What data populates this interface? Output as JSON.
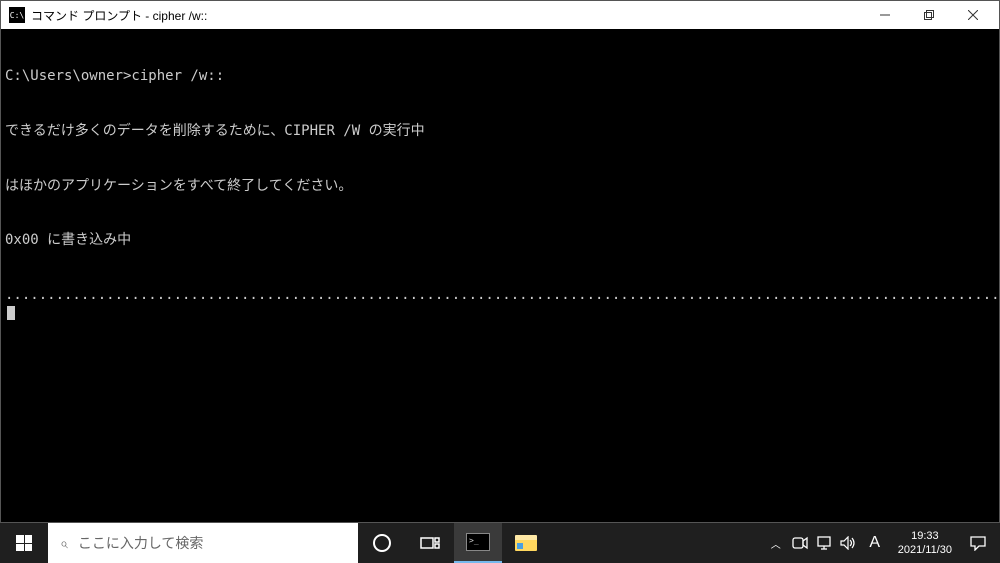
{
  "window": {
    "icon_text": "C:\\",
    "title": "コマンド プロンプト - cipher  /w::"
  },
  "terminal": {
    "prompt_line": "C:\\Users\\owner>cipher /w::",
    "line2": "できるだけ多くのデータを削除するために、CIPHER /W の実行中",
    "line3": "はほかのアプリケーションをすべて終了してください。",
    "line4": "0x00 に書き込み中",
    "progress_dots": "................................................................................................................................................."
  },
  "taskbar": {
    "search_placeholder": "ここに入力して検索",
    "ime_indicator": "A",
    "time": "19:33",
    "date": "2021/11/30"
  }
}
